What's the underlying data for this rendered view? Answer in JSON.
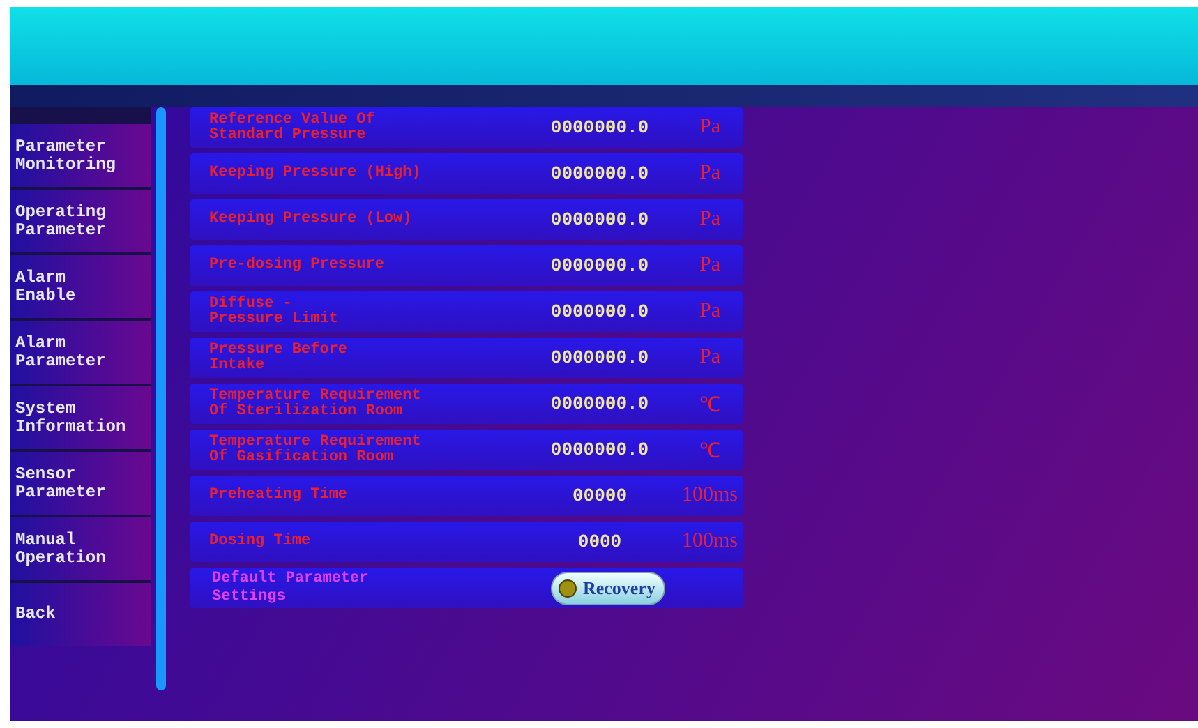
{
  "sidebar": {
    "items": [
      {
        "label": "Parameter\nMonitoring"
      },
      {
        "label": "Operating\nParameter"
      },
      {
        "label": "Alarm\nEnable"
      },
      {
        "label": "Alarm\nParameter"
      },
      {
        "label": "System\nInformation"
      },
      {
        "label": "Sensor\nParameter"
      },
      {
        "label": "Manual\nOperation"
      },
      {
        "label": "Back"
      }
    ]
  },
  "parameters": [
    {
      "label": "Reference Value Of\nStandard Pressure",
      "value": "0000000.0",
      "unit": "Pa"
    },
    {
      "label": "Keeping Pressure (High)",
      "value": "0000000.0",
      "unit": "Pa"
    },
    {
      "label": "Keeping Pressure (Low)",
      "value": "0000000.0",
      "unit": "Pa"
    },
    {
      "label": "Pre-dosing Pressure",
      "value": "0000000.0",
      "unit": "Pa"
    },
    {
      "label": "Diffuse -\nPressure Limit",
      "value": "0000000.0",
      "unit": "Pa"
    },
    {
      "label": "Pressure Before\nIntake",
      "value": "0000000.0",
      "unit": "Pa"
    },
    {
      "label": "Temperature Requirement\nOf Sterilization Room",
      "value": "0000000.0",
      "unit": "℃"
    },
    {
      "label": "Temperature Requirement\nOf Gasification Room",
      "value": "0000000.0",
      "unit": "℃"
    },
    {
      "label": "Preheating Time",
      "value": "00000",
      "unit": "100ms"
    },
    {
      "label": "Dosing Time",
      "value": "0000",
      "unit": "100ms"
    }
  ],
  "default_settings": {
    "label": "Default Parameter\nSettings",
    "button": "Recovery"
  }
}
